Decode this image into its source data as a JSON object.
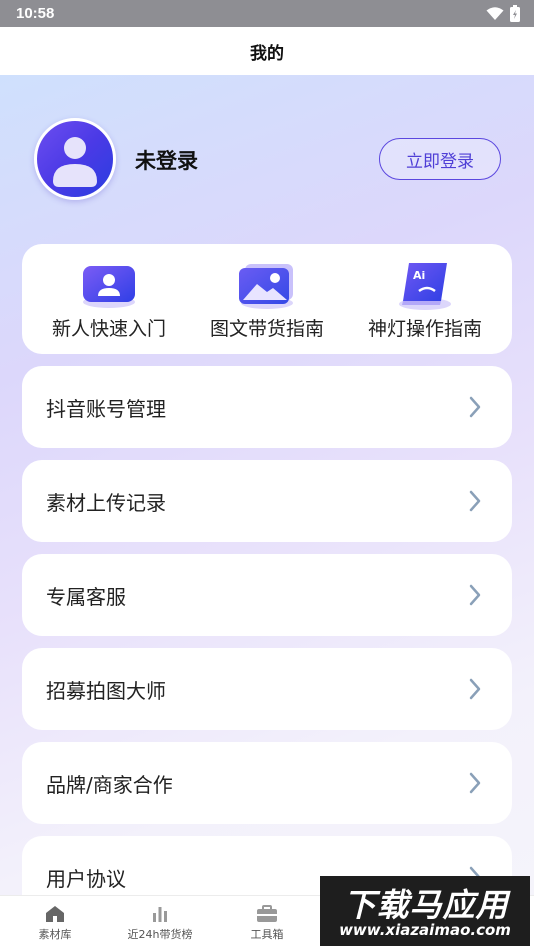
{
  "status_bar": {
    "time": "10:58"
  },
  "nav": {
    "title": "我的"
  },
  "profile": {
    "username": "未登录",
    "login_button": "立即登录"
  },
  "guides": [
    {
      "label": "新人快速入门",
      "icon": "user-card-icon"
    },
    {
      "label": "图文带货指南",
      "icon": "image-gallery-icon"
    },
    {
      "label": "神灯操作指南",
      "icon": "ai-book-icon"
    }
  ],
  "menu": [
    {
      "label": "抖音账号管理"
    },
    {
      "label": "素材上传记录"
    },
    {
      "label": "专属客服"
    },
    {
      "label": "招募拍图大师"
    },
    {
      "label": "品牌/商家合作"
    },
    {
      "label": "用户协议"
    }
  ],
  "tabs": [
    {
      "label": "素材库",
      "icon": "home-icon"
    },
    {
      "label": "近24h带货榜",
      "icon": "bar-chart-icon"
    },
    {
      "label": "工具箱",
      "icon": "toolbox-icon"
    }
  ],
  "watermark": {
    "title": "下载马应用",
    "url": "www.xiazaimao.com"
  },
  "colors": {
    "accent": "#5b47df",
    "status_bar": "#8e8e93",
    "chevron": "#8aa0b8"
  }
}
